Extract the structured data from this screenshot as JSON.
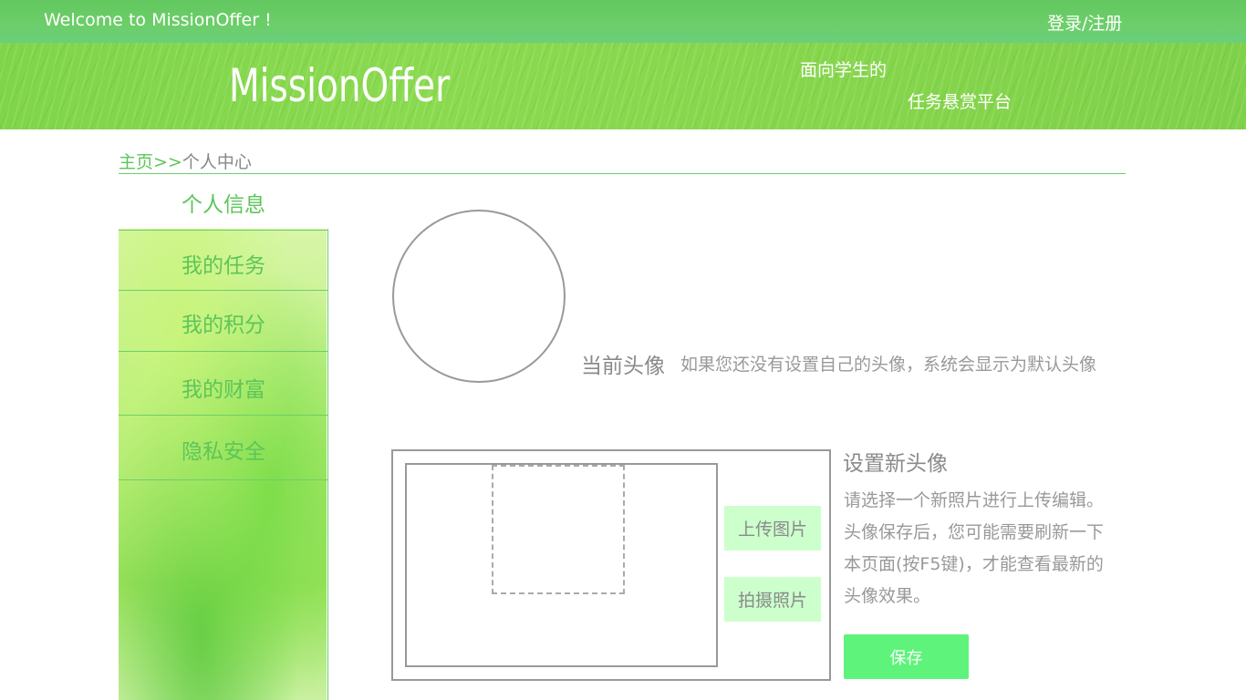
{
  "header": {
    "welcome": "Welcome to MissionOffer !",
    "login": "登录/注册"
  },
  "banner": {
    "logo": "MissionOffer",
    "slogan_line1": "面向学生的",
    "slogan_line2": "任务悬赏平台"
  },
  "breadcrumb": {
    "home": "主页",
    "separator": ">>",
    "current": "个人中心"
  },
  "sidebar": {
    "items": [
      {
        "label": "个人信息",
        "active": true
      },
      {
        "label": "我的任务"
      },
      {
        "label": "我的积分"
      },
      {
        "label": "我的财富"
      },
      {
        "label": "隐私安全"
      }
    ]
  },
  "avatar": {
    "label": "当前头像",
    "hint": "如果您还没有设置自己的头像，系统会显示为默认头像"
  },
  "editor": {
    "upload_button": "上传图片",
    "camera_button": "拍摄照片",
    "title": "设置新头像",
    "description": [
      "请选择一个新照片进行上传编辑。",
      "头像保存后，您可能需要刷新一下",
      "本页面(按F5键)，才能查看最新的",
      "头像效果。"
    ],
    "save_button": "保存"
  },
  "colors": {
    "accent_green": "#5dc55a",
    "topbar_green": "#66cc66",
    "button_light_green": "#ccffcc",
    "save_green": "#5ef37a"
  }
}
